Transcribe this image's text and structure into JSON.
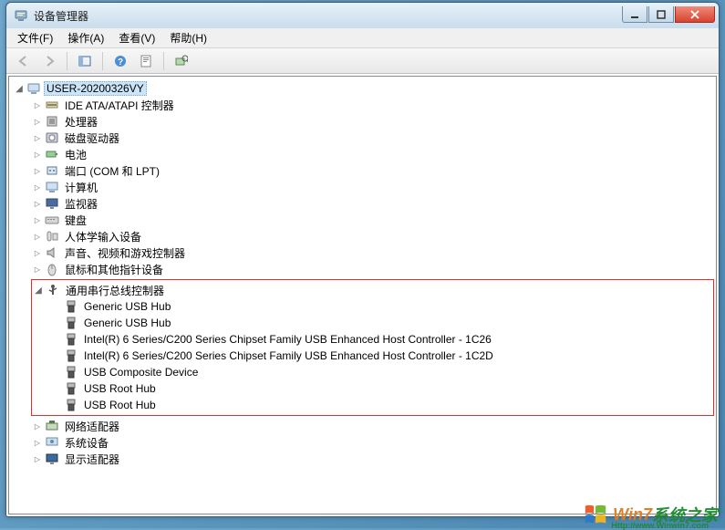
{
  "window": {
    "title": "设备管理器"
  },
  "menu": {
    "file": "文件(F)",
    "action": "操作(A)",
    "view": "查看(V)",
    "help": "帮助(H)"
  },
  "tree": {
    "root": "USER-20200326VY",
    "categories": [
      {
        "label": "IDE ATA/ATAPI 控制器",
        "icon": "ide"
      },
      {
        "label": "处理器",
        "icon": "cpu"
      },
      {
        "label": "磁盘驱动器",
        "icon": "disk"
      },
      {
        "label": "电池",
        "icon": "battery"
      },
      {
        "label": "端口 (COM 和 LPT)",
        "icon": "port"
      },
      {
        "label": "计算机",
        "icon": "computer"
      },
      {
        "label": "监视器",
        "icon": "monitor"
      },
      {
        "label": "键盘",
        "icon": "keyboard"
      },
      {
        "label": "人体学输入设备",
        "icon": "hid"
      },
      {
        "label": "声音、视频和游戏控制器",
        "icon": "sound"
      },
      {
        "label": "鼠标和其他指针设备",
        "icon": "mouse"
      }
    ],
    "usb_category": "通用串行总线控制器",
    "usb_items": [
      "Generic USB Hub",
      "Generic USB Hub",
      "Intel(R) 6 Series/C200 Series Chipset Family USB Enhanced Host Controller - 1C26",
      "Intel(R) 6 Series/C200 Series Chipset Family USB Enhanced Host Controller - 1C2D",
      "USB Composite Device",
      "USB Root Hub",
      "USB Root Hub"
    ],
    "after": [
      {
        "label": "网络适配器",
        "icon": "network"
      },
      {
        "label": "系统设备",
        "icon": "system"
      },
      {
        "label": "显示适配器",
        "icon": "display"
      }
    ]
  },
  "watermark": {
    "brand_a": "Win7",
    "brand_b": "系统之家",
    "url": "Http://www.Winwin7.com"
  }
}
